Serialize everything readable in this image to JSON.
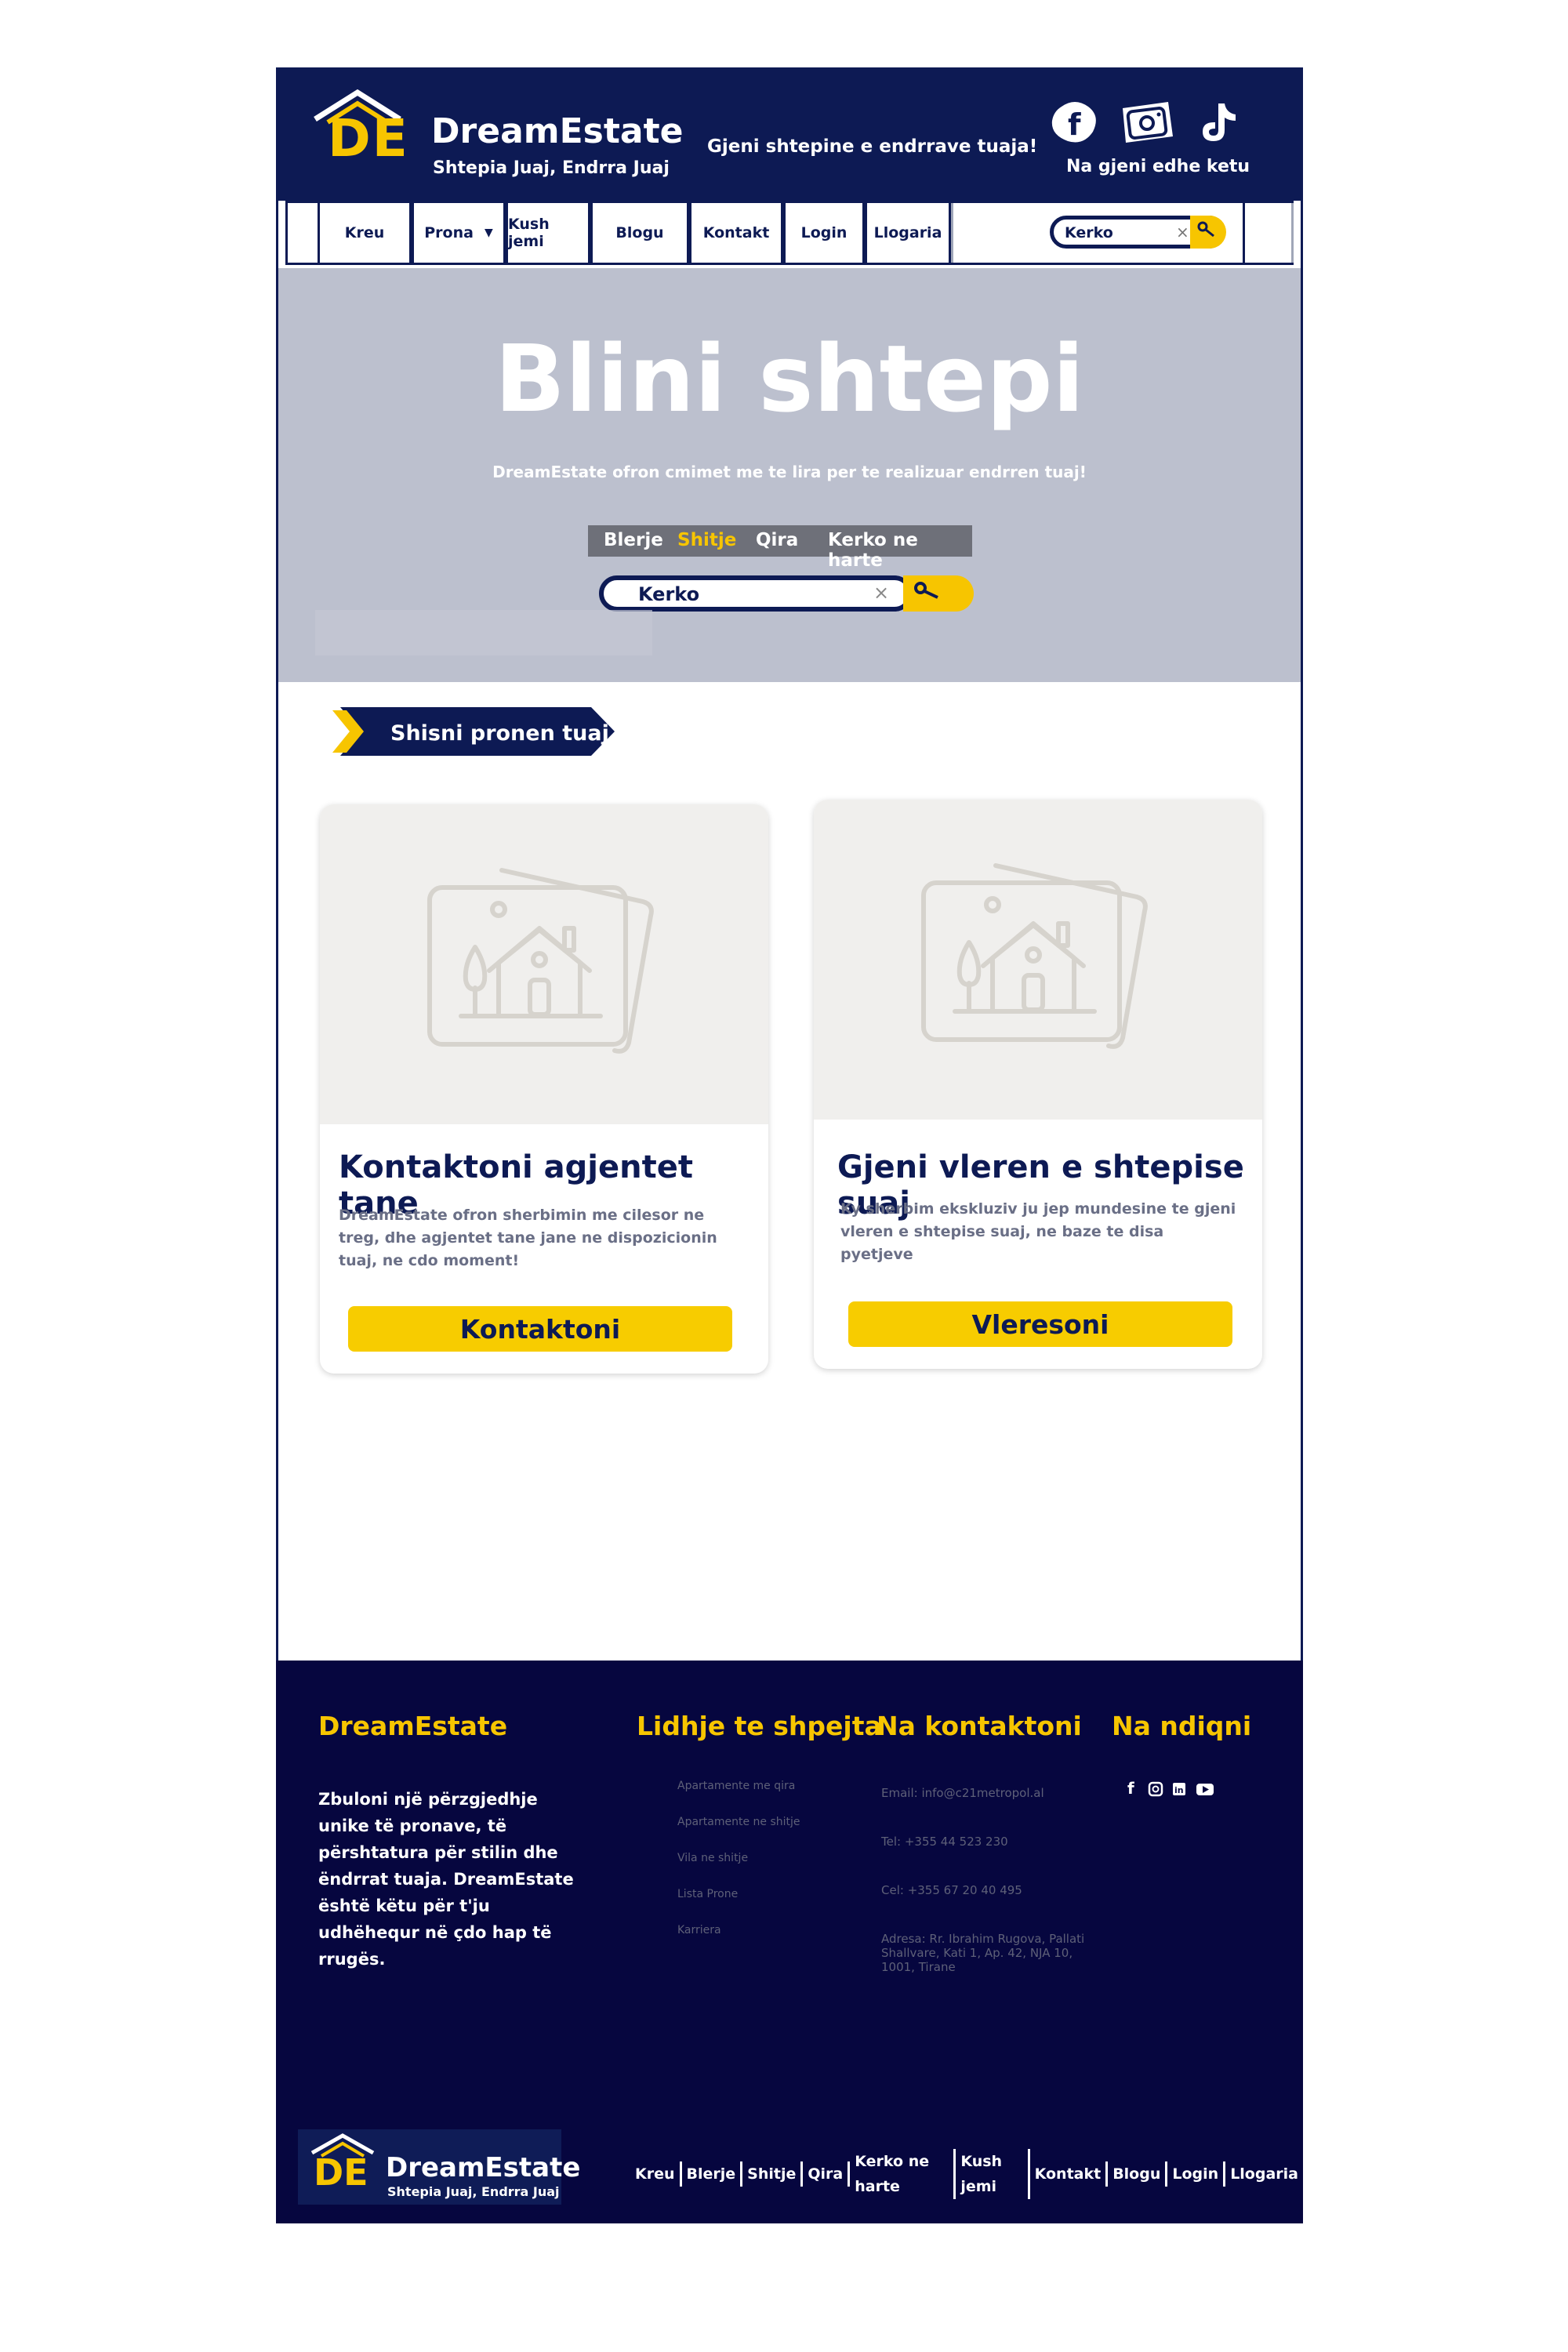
{
  "header": {
    "logo_mark": "DE",
    "brand_name": "DreamEstate",
    "brand_tagline": "Shtepia Juaj, Endrra Juaj",
    "slogan": "Gjeni shtepine e endrrave tuaja!",
    "social_caption": "Na gjeni edhe ketu",
    "social_icons": [
      "facebook-icon",
      "instagram-icon",
      "tiktok-icon"
    ]
  },
  "nav": {
    "items": [
      "Kreu",
      "Prona",
      "Kush jemi",
      "Blogu",
      "Kontakt",
      "Login",
      "Llogaria"
    ],
    "search_value": "Kerko"
  },
  "hero": {
    "title": "Blini shtepi",
    "subtitle": "DreamEstate ofron cmimet me te lira per te realizuar endrren tuaj!",
    "tabs": [
      "Blerje",
      "Shitje",
      "Qira",
      "Kerko ne harte"
    ],
    "active_tab": "Shitje",
    "search_value": "Kerko"
  },
  "section": {
    "ribbon_label": "Shisni pronen tuaj"
  },
  "cards": [
    {
      "title": "Kontaktoni agjentet tane",
      "text": "DreamEstate ofron sherbimin me cilesor ne treg, dhe agjentet tane jane ne dispozicionin tuaj, ne cdo moment!",
      "button": "Kontaktoni"
    },
    {
      "title": "Gjeni vleren e shtepise suaj",
      "text": "Ky sherbim ekskluziv ju jep mundesine te gjeni vleren e shtepise suaj, ne baze te disa pyetjeve",
      "button": "Vleresoni"
    }
  ],
  "footer": {
    "brand_heading": "DreamEstate",
    "description": "Zbuloni një përzgjedhje unike të pronave, të përshtatura për stilin dhe ëndrrat tuaja. DreamEstate është këtu për t'ju udhëhequr në çdo hap të rrugës.",
    "links_heading": "Lidhje te shpejta",
    "links": [
      "Apartamente me qira",
      "Apartamente ne shitje",
      "Vila ne shitje",
      "Lista Prone",
      "Karriera"
    ],
    "contact_heading": "Na kontaktoni",
    "contact": {
      "email": "Email: info@c21metropol.al",
      "tel": "Tel: +355 44 523 230",
      "cel": "Cel: +355 67 20 40 495",
      "address": "Adresa: Rr. Ibrahim Rugova, Pallati Shallvare, Kati 1, Ap. 42, NJA 10, 1001, Tirane"
    },
    "follow_heading": "Na ndiqni",
    "follow_icons": [
      "facebook-icon",
      "instagram-icon",
      "linkedin-icon",
      "youtube-icon"
    ],
    "logo_mark": "DE",
    "logo_name": "DreamEstate",
    "logo_tagline": "Shtepia Juaj, Endrra Juaj",
    "nav": [
      "Kreu",
      "Blerje",
      "Shitje",
      "Qira",
      "Kerko ne harte",
      "Kush jemi",
      "Kontakt",
      "Blogu",
      "Login",
      "Llogaria"
    ]
  },
  "colors": {
    "navy": "#0d1a54",
    "footer_navy": "#06063f",
    "accent_yellow": "#f7c500",
    "hero_gray": "#bcc0ce"
  }
}
